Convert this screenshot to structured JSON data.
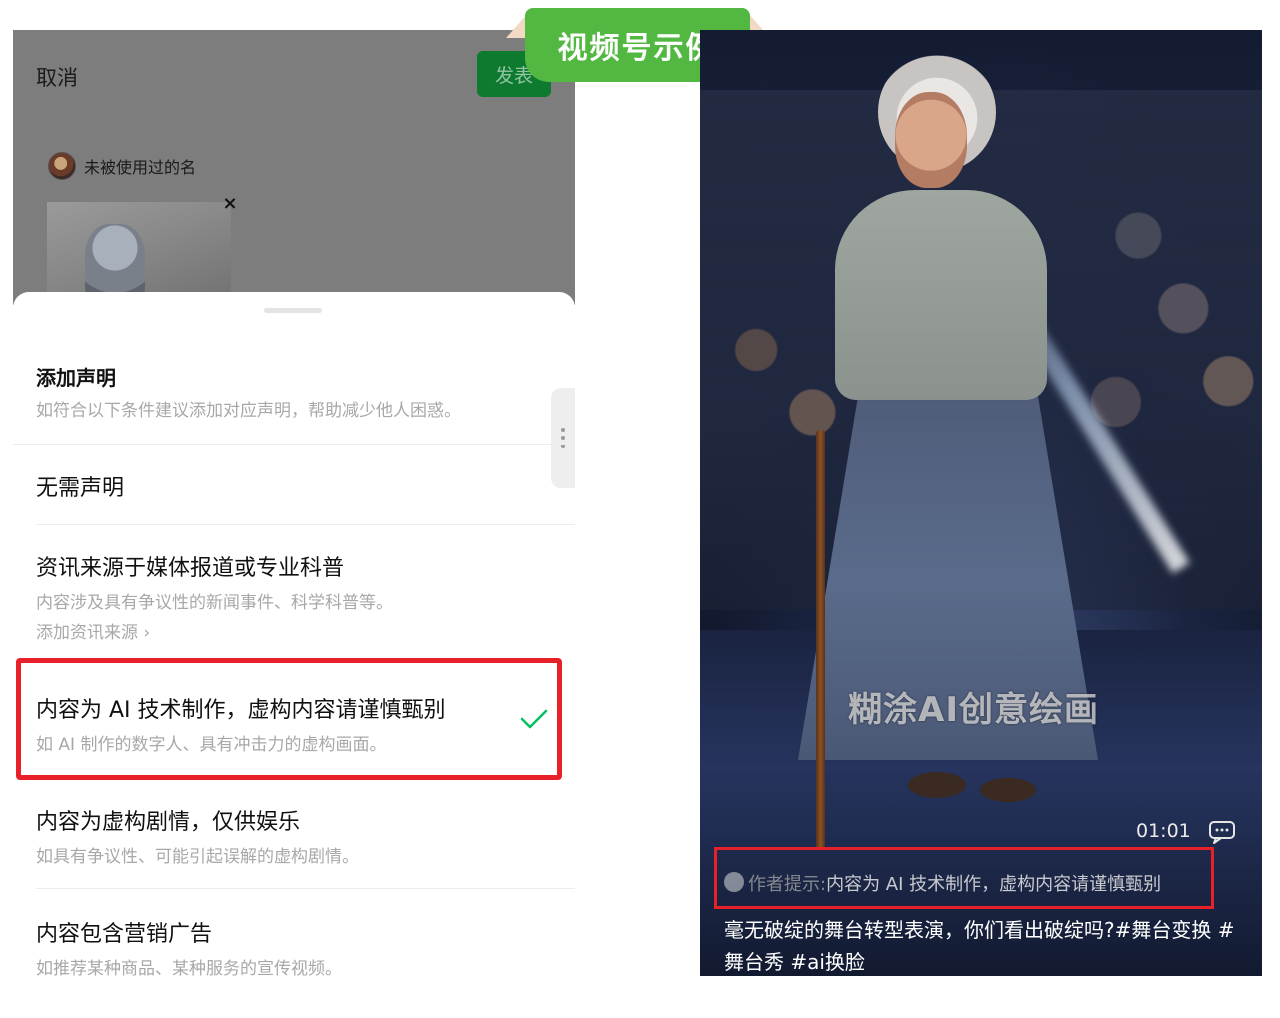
{
  "badge": {
    "label": "视频号示例"
  },
  "left": {
    "header": {
      "cancel_label": "取消",
      "publish_label": "发表"
    },
    "account": {
      "name": "未被使用过的名"
    },
    "thumbnail": {
      "close_icon": "close-icon"
    },
    "sheet": {
      "title": "添加声明",
      "subtitle": "如符合以下条件建议添加对应声明，帮助减少他人困惑。",
      "options": [
        {
          "title": "无需声明",
          "desc": "",
          "link": ""
        },
        {
          "title": "资讯来源于媒体报道或专业科普",
          "desc": "内容涉及具有争议性的新闻事件、科学科普等。",
          "link": "添加资讯来源 ›"
        },
        {
          "title": "内容为 AI 技术制作，虚构内容请谨慎甄别",
          "desc": "如 AI 制作的数字人、具有冲击力的虚构画面。",
          "link": "",
          "selected": true
        },
        {
          "title": "内容为虚构剧情，仅供娱乐",
          "desc": "如具有争议性、可能引起误解的虚构剧情。",
          "link": ""
        },
        {
          "title": "内容包含营销广告",
          "desc": "如推荐某种商品、某种服务的宣传视频。",
          "link": ""
        }
      ],
      "selected_icon": "checkmark-icon",
      "accent_color": "#07c160",
      "highlight_color": "#e8202a"
    }
  },
  "right": {
    "watermark": "糊涂AI创意绘画",
    "timestamp": "01:01",
    "comment_icon": "comment-icon",
    "hint": {
      "prefix": "作者提示:",
      "text": "内容为 AI 技术制作，虚构内容请谨慎甄别"
    },
    "caption": "毫无破绽的舞台转型表演，你们看出破绽吗?#舞台变换 #舞台秀 #ai换脸"
  }
}
